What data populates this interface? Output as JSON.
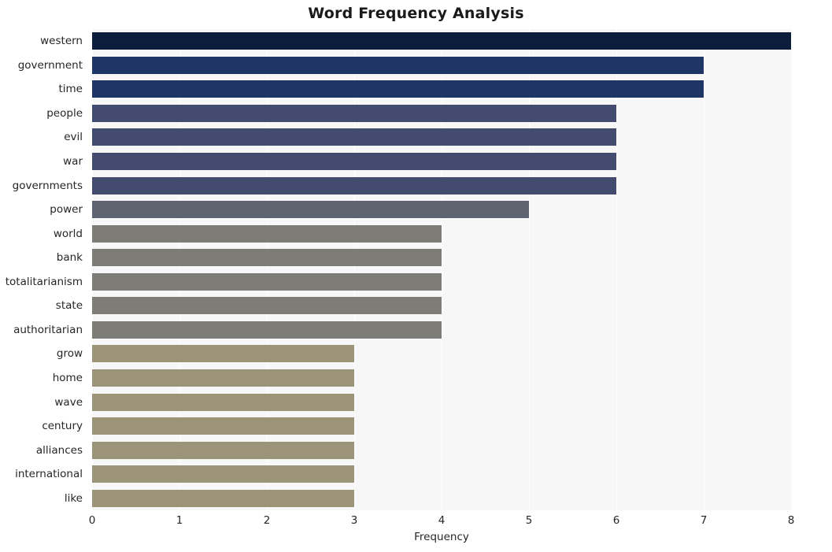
{
  "chart_data": {
    "type": "bar",
    "orientation": "horizontal",
    "title": "Word Frequency Analysis",
    "xlabel": "Frequency",
    "ylabel": "",
    "categories": [
      "western",
      "government",
      "time",
      "people",
      "evil",
      "war",
      "governments",
      "power",
      "world",
      "bank",
      "totalitarianism",
      "state",
      "authoritarian",
      "grow",
      "home",
      "wave",
      "century",
      "alliances",
      "international",
      "like"
    ],
    "values": [
      8,
      7,
      7,
      6,
      6,
      6,
      6,
      5,
      4,
      4,
      4,
      4,
      4,
      3,
      3,
      3,
      3,
      3,
      3,
      3
    ],
    "bar_colors": [
      "#0b1d3a",
      "#1f3566",
      "#1f3566",
      "#434c6e",
      "#434c6e",
      "#434c6e",
      "#434c6e",
      "#5f6570",
      "#7e7c77",
      "#7e7c77",
      "#7e7c77",
      "#7e7c77",
      "#7e7c77",
      "#9c9478",
      "#9c9478",
      "#9c9478",
      "#9c9478",
      "#9c9478",
      "#9c9478",
      "#9c9478"
    ],
    "xlim": [
      0,
      8
    ],
    "xticks": [
      0,
      1,
      2,
      3,
      4,
      5,
      6,
      7,
      8
    ],
    "xtick_labels": [
      "0",
      "1",
      "2",
      "3",
      "4",
      "5",
      "6",
      "7",
      "8"
    ],
    "grid": true,
    "grid_axis": "x",
    "legend": null,
    "plot_background": "#f7f7f7",
    "figure_background": "#ffffff"
  }
}
